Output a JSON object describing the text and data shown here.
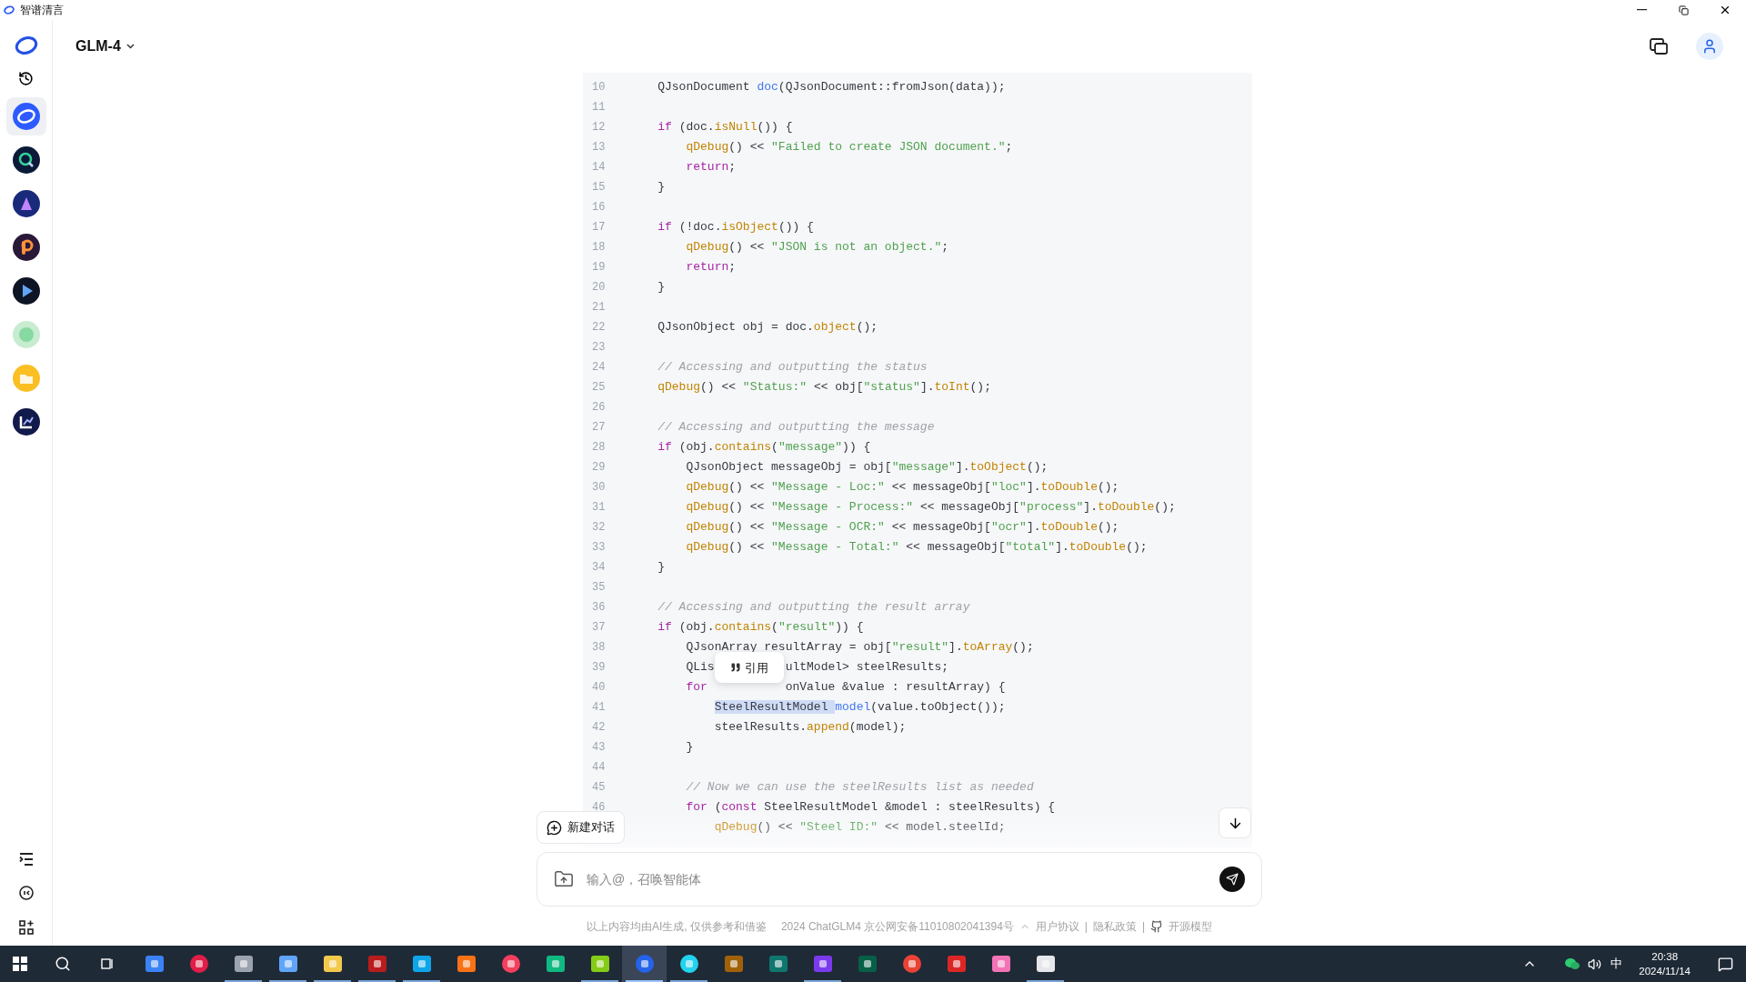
{
  "window": {
    "title": "智谱清言"
  },
  "header": {
    "model": "GLM-4"
  },
  "sidebar": {
    "apps": [
      {
        "selected": true
      },
      {
        "selected": false
      },
      {
        "selected": false
      },
      {
        "selected": false
      },
      {
        "selected": false
      },
      {
        "selected": false
      },
      {
        "selected": false
      },
      {
        "selected": false
      }
    ]
  },
  "code_block": {
    "lines": [
      {
        "number": "10",
        "tokens": [
          {
            "kind": "plain",
            "text": "    QJsonDocument "
          },
          {
            "kind": "var",
            "text": "doc"
          },
          {
            "kind": "plain",
            "text": "(QJsonDocument::fromJson(data));"
          }
        ]
      },
      {
        "number": "11"
      },
      {
        "number": "12",
        "tokens": [
          {
            "kind": "keyword",
            "text": "    if"
          },
          {
            "kind": "plain",
            "text": " (doc."
          },
          {
            "kind": "function",
            "text": "isNull"
          },
          {
            "kind": "plain",
            "text": "()) {"
          }
        ]
      },
      {
        "number": "13",
        "tokens": [
          {
            "kind": "function",
            "text": "        qDebug"
          },
          {
            "kind": "plain",
            "text": "() << "
          },
          {
            "kind": "string",
            "text": "\"Failed to create JSON document.\""
          },
          {
            "kind": "plain",
            "text": ";"
          }
        ]
      },
      {
        "number": "14",
        "tokens": [
          {
            "kind": "keyword",
            "text": "        return"
          },
          {
            "kind": "plain",
            "text": ";"
          }
        ]
      },
      {
        "number": "15",
        "tokens": [
          {
            "kind": "plain",
            "text": "    }"
          }
        ]
      },
      {
        "number": "16"
      },
      {
        "number": "17",
        "tokens": [
          {
            "kind": "keyword",
            "text": "    if"
          },
          {
            "kind": "plain",
            "text": " (!doc."
          },
          {
            "kind": "function",
            "text": "isObject"
          },
          {
            "kind": "plain",
            "text": "()) {"
          }
        ]
      },
      {
        "number": "18",
        "tokens": [
          {
            "kind": "function",
            "text": "        qDebug"
          },
          {
            "kind": "plain",
            "text": "() << "
          },
          {
            "kind": "string",
            "text": "\"JSON is not an object.\""
          },
          {
            "kind": "plain",
            "text": ";"
          }
        ]
      },
      {
        "number": "19",
        "tokens": [
          {
            "kind": "keyword",
            "text": "        return"
          },
          {
            "kind": "plain",
            "text": ";"
          }
        ]
      },
      {
        "number": "20",
        "tokens": [
          {
            "kind": "plain",
            "text": "    }"
          }
        ]
      },
      {
        "number": "21"
      },
      {
        "number": "22",
        "tokens": [
          {
            "kind": "plain",
            "text": "    QJsonObject obj = doc."
          },
          {
            "kind": "function",
            "text": "object"
          },
          {
            "kind": "plain",
            "text": "();"
          }
        ]
      },
      {
        "number": "23"
      },
      {
        "number": "24",
        "tokens": [
          {
            "kind": "comment",
            "text": "    // Accessing and outputting the status"
          }
        ]
      },
      {
        "number": "25",
        "tokens": [
          {
            "kind": "function",
            "text": "    qDebug"
          },
          {
            "kind": "plain",
            "text": "() << "
          },
          {
            "kind": "string",
            "text": "\"Status:\""
          },
          {
            "kind": "plain",
            "text": " << obj["
          },
          {
            "kind": "string",
            "text": "\"status\""
          },
          {
            "kind": "plain",
            "text": "]."
          },
          {
            "kind": "function",
            "text": "toInt"
          },
          {
            "kind": "plain",
            "text": "();"
          }
        ]
      },
      {
        "number": "26"
      },
      {
        "number": "27",
        "tokens": [
          {
            "kind": "comment",
            "text": "    // Accessing and outputting the message"
          }
        ]
      },
      {
        "number": "28",
        "tokens": [
          {
            "kind": "keyword",
            "text": "    if"
          },
          {
            "kind": "plain",
            "text": " (obj."
          },
          {
            "kind": "function",
            "text": "contains"
          },
          {
            "kind": "plain",
            "text": "("
          },
          {
            "kind": "string",
            "text": "\"message\""
          },
          {
            "kind": "plain",
            "text": ")) {"
          }
        ]
      },
      {
        "number": "29",
        "tokens": [
          {
            "kind": "plain",
            "text": "        QJsonObject messageObj = obj["
          },
          {
            "kind": "string",
            "text": "\"message\""
          },
          {
            "kind": "plain",
            "text": "]."
          },
          {
            "kind": "function",
            "text": "toObject"
          },
          {
            "kind": "plain",
            "text": "();"
          }
        ]
      },
      {
        "number": "30",
        "tokens": [
          {
            "kind": "function",
            "text": "        qDebug"
          },
          {
            "kind": "plain",
            "text": "() << "
          },
          {
            "kind": "string",
            "text": "\"Message - Loc:\""
          },
          {
            "kind": "plain",
            "text": " << messageObj["
          },
          {
            "kind": "string",
            "text": "\"loc\""
          },
          {
            "kind": "plain",
            "text": "]."
          },
          {
            "kind": "function",
            "text": "toDouble"
          },
          {
            "kind": "plain",
            "text": "();"
          }
        ]
      },
      {
        "number": "31",
        "tokens": [
          {
            "kind": "function",
            "text": "        qDebug"
          },
          {
            "kind": "plain",
            "text": "() << "
          },
          {
            "kind": "string",
            "text": "\"Message - Process:\""
          },
          {
            "kind": "plain",
            "text": " << messageObj["
          },
          {
            "kind": "string",
            "text": "\"process\""
          },
          {
            "kind": "plain",
            "text": "]."
          },
          {
            "kind": "function",
            "text": "toDouble"
          },
          {
            "kind": "plain",
            "text": "();"
          }
        ]
      },
      {
        "number": "32",
        "tokens": [
          {
            "kind": "function",
            "text": "        qDebug"
          },
          {
            "kind": "plain",
            "text": "() << "
          },
          {
            "kind": "string",
            "text": "\"Message - OCR:\""
          },
          {
            "kind": "plain",
            "text": " << messageObj["
          },
          {
            "kind": "string",
            "text": "\"ocr\""
          },
          {
            "kind": "plain",
            "text": "]."
          },
          {
            "kind": "function",
            "text": "toDouble"
          },
          {
            "kind": "plain",
            "text": "();"
          }
        ]
      },
      {
        "number": "33",
        "tokens": [
          {
            "kind": "function",
            "text": "        qDebug"
          },
          {
            "kind": "plain",
            "text": "() << "
          },
          {
            "kind": "string",
            "text": "\"Message - Total:\""
          },
          {
            "kind": "plain",
            "text": " << messageObj["
          },
          {
            "kind": "string",
            "text": "\"total\""
          },
          {
            "kind": "plain",
            "text": "]."
          },
          {
            "kind": "function",
            "text": "toDouble"
          },
          {
            "kind": "plain",
            "text": "();"
          }
        ]
      },
      {
        "number": "34",
        "tokens": [
          {
            "kind": "plain",
            "text": "    }"
          }
        ]
      },
      {
        "number": "35"
      },
      {
        "number": "36",
        "tokens": [
          {
            "kind": "comment",
            "text": "    // Accessing and outputting the result array"
          }
        ]
      },
      {
        "number": "37",
        "tokens": [
          {
            "kind": "keyword",
            "text": "    if"
          },
          {
            "kind": "plain",
            "text": " (obj."
          },
          {
            "kind": "function",
            "text": "contains"
          },
          {
            "kind": "plain",
            "text": "("
          },
          {
            "kind": "string",
            "text": "\"result\""
          },
          {
            "kind": "plain",
            "text": ")) {"
          }
        ]
      },
      {
        "number": "38",
        "tokens": [
          {
            "kind": "plain",
            "text": "        QJsonArray resultArray = obj["
          },
          {
            "kind": "string",
            "text": "\"result\""
          },
          {
            "kind": "plain",
            "text": "]."
          },
          {
            "kind": "function",
            "text": "toArray"
          },
          {
            "kind": "plain",
            "text": "();"
          }
        ]
      },
      {
        "number": "39",
        "tokens": [
          {
            "kind": "plain",
            "text": "        QLis"
          },
          {
            "kind": "anchor"
          },
          {
            "kind": "plain",
            "text": "ultModel> steelResults;"
          }
        ]
      },
      {
        "number": "40",
        "tokens": [
          {
            "kind": "keyword",
            "text": "        for "
          },
          {
            "kind": "covered"
          },
          {
            "kind": "plain",
            "text": "onValue &value : resultArray) {"
          }
        ]
      },
      {
        "number": "41",
        "tokens": [
          {
            "kind": "selection",
            "text": "            SteelResultModel "
          },
          {
            "kind": "var",
            "text": "model"
          },
          {
            "kind": "plain",
            "text": "(value.toObject());"
          }
        ]
      },
      {
        "number": "42",
        "tokens": [
          {
            "kind": "plain",
            "text": "            steelResults."
          },
          {
            "kind": "function",
            "text": "append"
          },
          {
            "kind": "plain",
            "text": "(model);"
          }
        ]
      },
      {
        "number": "43",
        "tokens": [
          {
            "kind": "plain",
            "text": "        }"
          }
        ]
      },
      {
        "number": "44"
      },
      {
        "number": "45",
        "tokens": [
          {
            "kind": "comment",
            "text": "        // Now we can use the steelResults list as needed"
          }
        ]
      },
      {
        "number": "46",
        "tokens": [
          {
            "kind": "keyword",
            "text": "        for"
          },
          {
            "kind": "plain",
            "text": " ("
          },
          {
            "kind": "keyword",
            "text": "const"
          },
          {
            "kind": "plain",
            "text": " SteelResultModel &model : steelResults) {"
          }
        ]
      },
      {
        "tokens": [
          {
            "kind": "function",
            "text": "            qDebug"
          },
          {
            "kind": "plain",
            "text": "() << "
          },
          {
            "kind": "string",
            "text": "\"Steel ID:\""
          },
          {
            "kind": "plain",
            "text": " << model.steelId;"
          }
        ]
      }
    ]
  },
  "quote_popup": {
    "label": "引用"
  },
  "new_chat_button": {
    "label": "新建对话"
  },
  "composer": {
    "placeholder": "输入@，召唤智能体"
  },
  "footer": {
    "parts": [
      {
        "kind": "text",
        "text": "以上内容均由AI生成, 仅供参考和借鉴"
      },
      {
        "kind": "text",
        "text": "2024 ChatGLM4 京公网安备11010802041394号"
      },
      {
        "kind": "chevron"
      },
      {
        "kind": "link",
        "text": "用户协议"
      },
      {
        "kind": "separator",
        "text": "|"
      },
      {
        "kind": "link",
        "text": "隐私政策"
      },
      {
        "kind": "separator",
        "text": "|"
      },
      {
        "kind": "github"
      },
      {
        "kind": "link",
        "text": "开源模型"
      }
    ]
  },
  "taskbar": {
    "apps": [
      {
        "running": false,
        "selected": false
      },
      {
        "running": false,
        "selected": false
      },
      {
        "running": true,
        "selected": false
      },
      {
        "running": true,
        "selected": false
      },
      {
        "running": true,
        "selected": false
      },
      {
        "running": true,
        "selected": false
      },
      {
        "running": true,
        "selected": false
      },
      {
        "running": false,
        "selected": false
      },
      {
        "running": false,
        "selected": false
      },
      {
        "running": false,
        "selected": false
      },
      {
        "running": true,
        "selected": false
      },
      {
        "running": true,
        "selected": true
      },
      {
        "running": true,
        "selected": false
      },
      {
        "running": false,
        "selected": false
      },
      {
        "running": false,
        "selected": false
      },
      {
        "running": true,
        "selected": false
      },
      {
        "running": false,
        "selected": false
      },
      {
        "running": false,
        "selected": false
      },
      {
        "running": false,
        "selected": false
      },
      {
        "running": false,
        "selected": false
      },
      {
        "running": true,
        "selected": false
      }
    ],
    "ime": "中",
    "time": "20:38",
    "date": "2024/11/14"
  }
}
